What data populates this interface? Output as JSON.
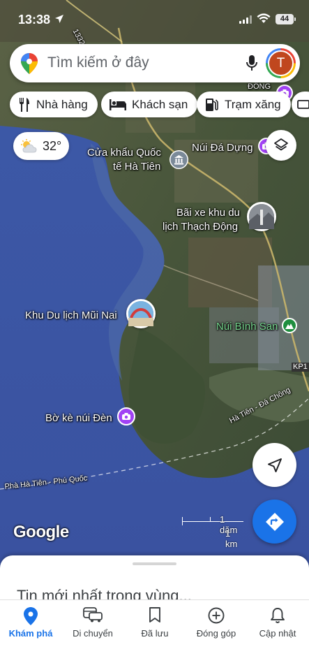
{
  "status_bar": {
    "time": "13:38",
    "battery": "44"
  },
  "search": {
    "placeholder": "Tìm kiếm ở đây",
    "avatar_letter": "T"
  },
  "chips": [
    {
      "label": "Nhà hàng",
      "icon": "fork-knife-icon"
    },
    {
      "label": "Khách sạn",
      "icon": "bed-icon"
    },
    {
      "label": "Trạm xăng",
      "icon": "gas-pump-icon"
    }
  ],
  "weather": {
    "temperature": "32°",
    "icon": "partly-cloudy-icon"
  },
  "map_labels": {
    "cua_khau_1": "Cửa khẩu Quốc",
    "cua_khau_2": "tế Hà Tiên",
    "nui_da_dung": "Núi Đá Dựng",
    "bai_xe_1": "Bãi xe khu du",
    "bai_xe_2": "lịch Thạch Động",
    "khu_du_lich": "Khu Du lịch Mũi Nai",
    "nui_binh_san": "Núi Bình San",
    "bo_ke": "Bờ kè núi Đèn",
    "ha_tien_da_chong": "Hà Tiên - Đá Chông",
    "pha_ha_tien": "Phà Hà Tiên - Phú Quốc",
    "route_1332": "1332",
    "kp1": "KP1",
    "partial_top": "ĐÔNG"
  },
  "scale": {
    "imperial": "1 dặm",
    "metric": "1 km"
  },
  "google_logo": "Google",
  "sheet": {
    "headline": "Tin mới nhất trong vùng..."
  },
  "nav": [
    {
      "label": "Khám phá",
      "icon": "location-pin-icon",
      "active": true
    },
    {
      "label": "Di chuyển",
      "icon": "car-icon",
      "active": false
    },
    {
      "label": "Đã lưu",
      "icon": "bookmark-icon",
      "active": false
    },
    {
      "label": "Đóng góp",
      "icon": "add-circle-icon",
      "active": false
    },
    {
      "label": "Cập nhật",
      "icon": "bell-icon",
      "active": false
    }
  ],
  "colors": {
    "accent": "#1a73e8",
    "sea": "#3d5aa8",
    "land": "#4a5a3a",
    "avatar_bg": "#c0471e",
    "poi_purple": "#a142f4",
    "poi_green": "#1e8e3e"
  }
}
